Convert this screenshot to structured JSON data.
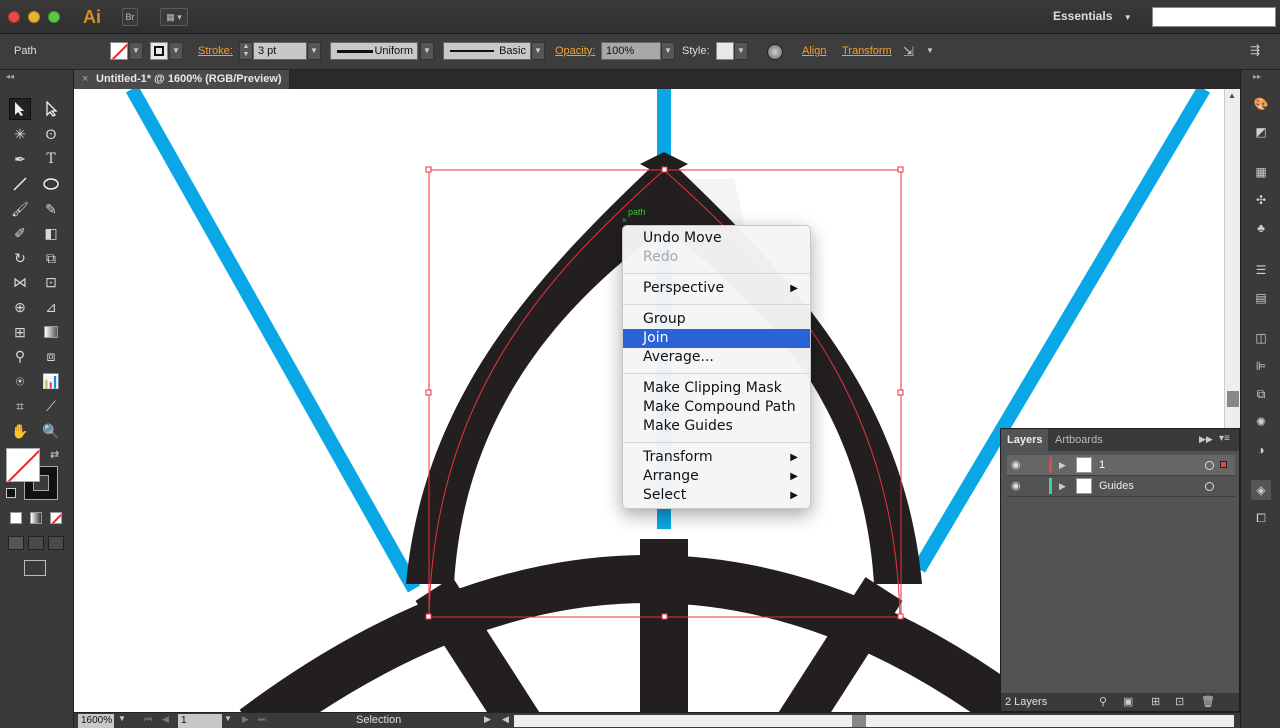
{
  "app": {
    "logo": "Ai",
    "bridge_button": "Br",
    "workspace": "Essentials"
  },
  "control_bar": {
    "selection_type": "Path",
    "stroke_label": "Stroke:",
    "stroke_weight": "3 pt",
    "stroke_profile": "Uniform",
    "brush_definition": "Basic",
    "opacity_label": "Opacity:",
    "opacity_value": "100%",
    "style_label": "Style:",
    "align_label": "Align",
    "transform_label": "Transform"
  },
  "document": {
    "tab_title": "Untitled-1* @ 1600% (RGB/Preview)",
    "hover_label": "path"
  },
  "context_menu": {
    "items": [
      {
        "label": "Undo Move",
        "enabled": true
      },
      {
        "label": "Redo",
        "enabled": false
      },
      {
        "label": "Perspective",
        "submenu": true
      },
      {
        "label": "Group"
      },
      {
        "label": "Join",
        "highlighted": true
      },
      {
        "label": "Average..."
      },
      {
        "label": "Make Clipping Mask"
      },
      {
        "label": "Make Compound Path"
      },
      {
        "label": "Make Guides"
      },
      {
        "label": "Transform",
        "submenu": true
      },
      {
        "label": "Arrange",
        "submenu": true
      },
      {
        "label": "Select",
        "submenu": true
      }
    ]
  },
  "layers_panel": {
    "tabs": [
      "Layers",
      "Artboards"
    ],
    "layers": [
      {
        "name": "1",
        "color": "#e0484a"
      },
      {
        "name": "Guides",
        "color": "#3ad0b0"
      }
    ],
    "footer": "2 Layers"
  },
  "status_bar": {
    "zoom": "1600%",
    "artboard": "1",
    "tool": "Selection"
  },
  "colors": {
    "accent_blue": "#0aa7e6",
    "artwork_dark": "#231f20",
    "selection_red": "#e8323c",
    "menu_highlight": "#2a62d8",
    "link_orange": "#f0a030"
  }
}
